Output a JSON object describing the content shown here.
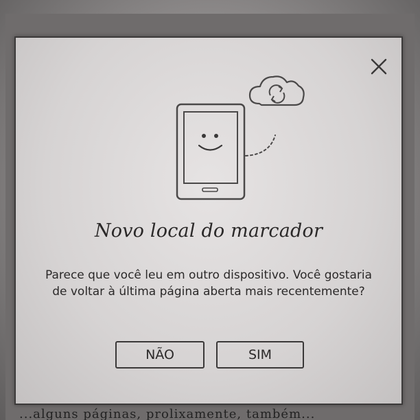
{
  "dialog": {
    "title": "Novo local do marcador",
    "message": "Parece que você leu em outro dispositivo. Você gostaria de voltar à última página aberta mais recentemente?",
    "buttons": {
      "no_label": "NÃO",
      "yes_label": "SIM"
    },
    "icons": {
      "close": "close-icon",
      "device": "ereader-device-icon",
      "cloud": "cloud-sync-icon"
    }
  },
  "background": {
    "text": "...alguns páginas, prolixamente, também..."
  },
  "colors": {
    "dialog_bg": "#dedbdb",
    "border": "#3a3838",
    "text": "#2b2929"
  }
}
